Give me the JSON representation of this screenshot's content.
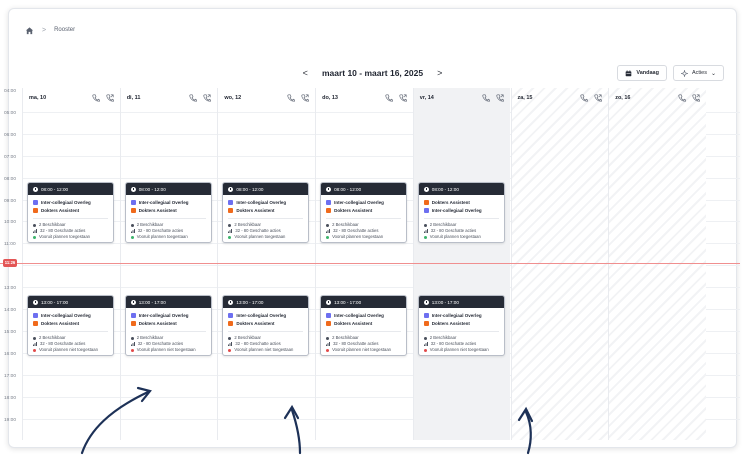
{
  "breadcrumb": {
    "home_icon": "home-icon",
    "separator": ">",
    "current": "Rooster"
  },
  "week_nav": {
    "prev": "<",
    "range": "maart 10 - maart 16, 2025",
    "next": ">"
  },
  "toolbar": {
    "today_label": "Vandaag",
    "today_icon": "calendar-icon",
    "actions_label": "Acties",
    "actions_icon": "sparkle-icon",
    "actions_caret": "⌄"
  },
  "times": [
    "04:00",
    "05:00",
    "06:00",
    "07:00",
    "08:00",
    "09:00",
    "10:00",
    "11:00",
    "12:00",
    "13:00",
    "14:00",
    "15:00",
    "16:00",
    "17:00",
    "18:00",
    "19:00"
  ],
  "now_badge": "11:26",
  "days": [
    {
      "label": "ma, 10",
      "state": "normal"
    },
    {
      "label": "di, 11",
      "state": "normal"
    },
    {
      "label": "wo, 12",
      "state": "normal"
    },
    {
      "label": "do, 13",
      "state": "normal"
    },
    {
      "label": "vr, 14",
      "state": "today"
    },
    {
      "label": "za, 15",
      "state": "weekend"
    },
    {
      "label": "zo, 16",
      "state": "weekend"
    }
  ],
  "colors": {
    "purple": "#6d6ff0",
    "orange": "#f06a1c",
    "green": "#3bb36b",
    "red": "#e24a4a",
    "card_head": "#262b36"
  },
  "morning_cards": [
    {
      "time": "08:00 - 12:00",
      "tags": [
        {
          "label": "Inter-collegiaal Overleg",
          "color": "purple"
        },
        {
          "label": "Dokters Assistent",
          "color": "orange"
        }
      ],
      "available": "2 Beschikbaar",
      "actions": "32 - 80 Geschatte acties",
      "planning": "Vooruit plannen toegestaan",
      "planning_color": "green"
    },
    {
      "time": "08:00 - 12:00",
      "tags": [
        {
          "label": "Inter-collegiaal Overleg",
          "color": "purple"
        },
        {
          "label": "Dokters Assistent",
          "color": "orange"
        }
      ],
      "available": "2 Beschikbaar",
      "actions": "32 - 80 Geschatte acties",
      "planning": "Vooruit plannen toegestaan",
      "planning_color": "green"
    },
    {
      "time": "08:00 - 12:00",
      "tags": [
        {
          "label": "Inter-collegiaal Overleg",
          "color": "purple"
        },
        {
          "label": "Dokters Assistent",
          "color": "orange"
        }
      ],
      "available": "2 Beschikbaar",
      "actions": "32 - 80 Geschatte acties",
      "planning": "Vooruit plannen toegestaan",
      "planning_color": "green"
    },
    {
      "time": "08:00 - 12:00",
      "tags": [
        {
          "label": "Inter-collegiaal Overleg",
          "color": "purple"
        },
        {
          "label": "Dokters Assistent",
          "color": "orange"
        }
      ],
      "available": "2 Beschikbaar",
      "actions": "32 - 80 Geschatte acties",
      "planning": "Vooruit plannen toegestaan",
      "planning_color": "green"
    },
    {
      "time": "08:00 - 12:00",
      "tags": [
        {
          "label": "Dokters Assistent",
          "color": "orange"
        },
        {
          "label": "Inter-collegiaal Overleg",
          "color": "purple"
        }
      ],
      "available": "2 Beschikbaar",
      "actions": "32 - 80 Geschatte acties",
      "planning": "Vooruit plannen toegestaan",
      "planning_color": "green"
    }
  ],
  "afternoon_cards": [
    {
      "time": "13:00 - 17:00",
      "tags": [
        {
          "label": "Inter-collegiaal Overleg",
          "color": "purple"
        },
        {
          "label": "Dokters Assistent",
          "color": "orange"
        }
      ],
      "available": "2 Beschikbaar",
      "actions": "32 - 80 Geschatte acties",
      "planning": "Vooruit plannen niet toegestaan",
      "planning_color": "red"
    },
    {
      "time": "13:00 - 17:00",
      "tags": [
        {
          "label": "Inter-collegiaal Overleg",
          "color": "purple"
        },
        {
          "label": "Dokters Assistent",
          "color": "orange"
        }
      ],
      "available": "2 Beschikbaar",
      "actions": "32 - 80 Geschatte acties",
      "planning": "Vooruit plannen niet toegestaan",
      "planning_color": "red"
    },
    {
      "time": "13:00 - 17:00",
      "tags": [
        {
          "label": "Inter-collegiaal Overleg",
          "color": "purple"
        },
        {
          "label": "Dokters Assistent",
          "color": "orange"
        }
      ],
      "available": "2 Beschikbaar",
      "actions": "32 - 80 Geschatte acties",
      "planning": "Vooruit plannen niet toegestaan",
      "planning_color": "red"
    },
    {
      "time": "13:00 - 17:00",
      "tags": [
        {
          "label": "Inter-collegiaal Overleg",
          "color": "purple"
        },
        {
          "label": "Dokters Assistent",
          "color": "orange"
        }
      ],
      "available": "2 Beschikbaar",
      "actions": "32 - 80 Geschatte acties",
      "planning": "Vooruit plannen niet toegestaan",
      "planning_color": "red"
    },
    {
      "time": "13:00 - 17:00",
      "tags": [
        {
          "label": "Inter-collegiaal Overleg",
          "color": "purple"
        },
        {
          "label": "Dokters Assistent",
          "color": "orange"
        }
      ],
      "available": "2 Beschikbaar",
      "actions": "32 - 80 Geschatte acties",
      "planning": "Vooruit plannen niet toegestaan",
      "planning_color": "red"
    }
  ]
}
